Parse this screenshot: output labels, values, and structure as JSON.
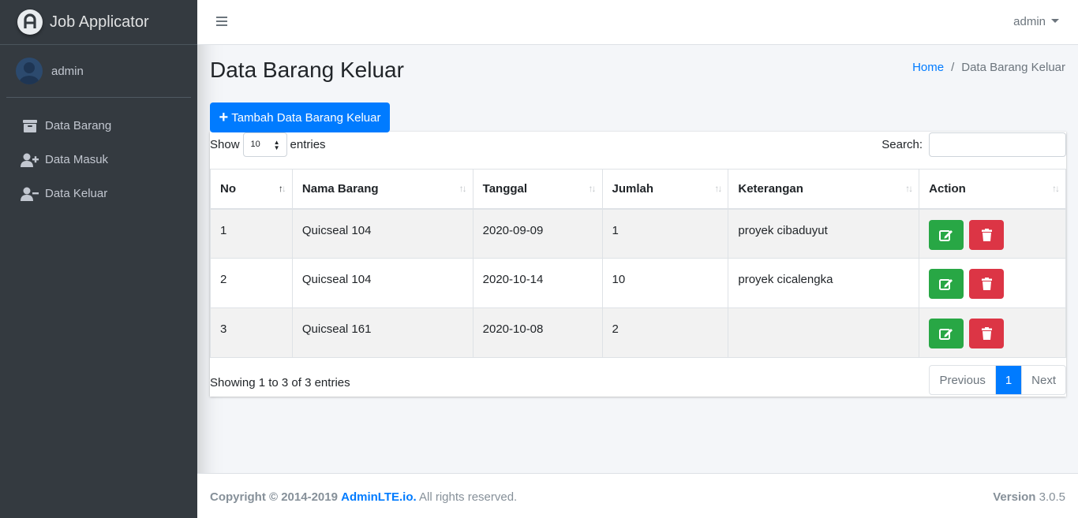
{
  "brand": {
    "title": "Job Applicator"
  },
  "user": {
    "name": "admin"
  },
  "sidebar": {
    "items": [
      {
        "label": "Data Barang",
        "icon": "archive-icon"
      },
      {
        "label": "Data Masuk",
        "icon": "user-plus-icon"
      },
      {
        "label": "Data Keluar",
        "icon": "user-minus-icon"
      }
    ]
  },
  "navbar": {
    "user_label": "admin"
  },
  "page": {
    "title": "Data Barang Keluar",
    "breadcrumb": {
      "home": "Home",
      "separator": "/",
      "current": "Data Barang Keluar"
    },
    "add_button": "Tambah Data Barang Keluar"
  },
  "table_controls": {
    "show_label": "Show",
    "entries_value": "10",
    "entries_label": "entries",
    "search_label": "Search:",
    "search_value": ""
  },
  "table": {
    "headers": [
      "No",
      "Nama Barang",
      "Tanggal",
      "Jumlah",
      "Keterangan",
      "Action"
    ],
    "rows": [
      {
        "no": "1",
        "nama": "Quicseal 104",
        "tanggal": "2020-09-09",
        "jumlah": "1",
        "keterangan": "proyek cibaduyut"
      },
      {
        "no": "2",
        "nama": "Quicseal 104",
        "tanggal": "2020-10-14",
        "jumlah": "10",
        "keterangan": "proyek cicalengka"
      },
      {
        "no": "3",
        "nama": "Quicseal 161",
        "tanggal": "2020-10-08",
        "jumlah": "2",
        "keterangan": ""
      }
    ]
  },
  "footer_info": "Showing 1 to 3 of 3 entries",
  "pagination": {
    "previous": "Previous",
    "current": "1",
    "next": "Next"
  },
  "footer": {
    "copyright": "Copyright © 2014-2019",
    "link": "AdminLTE.io.",
    "rights": "All rights reserved.",
    "version_label": "Version",
    "version": "3.0.5"
  },
  "colors": {
    "primary": "#007bff",
    "success": "#28a745",
    "danger": "#dc3545",
    "sidebar_bg": "#343a40"
  }
}
